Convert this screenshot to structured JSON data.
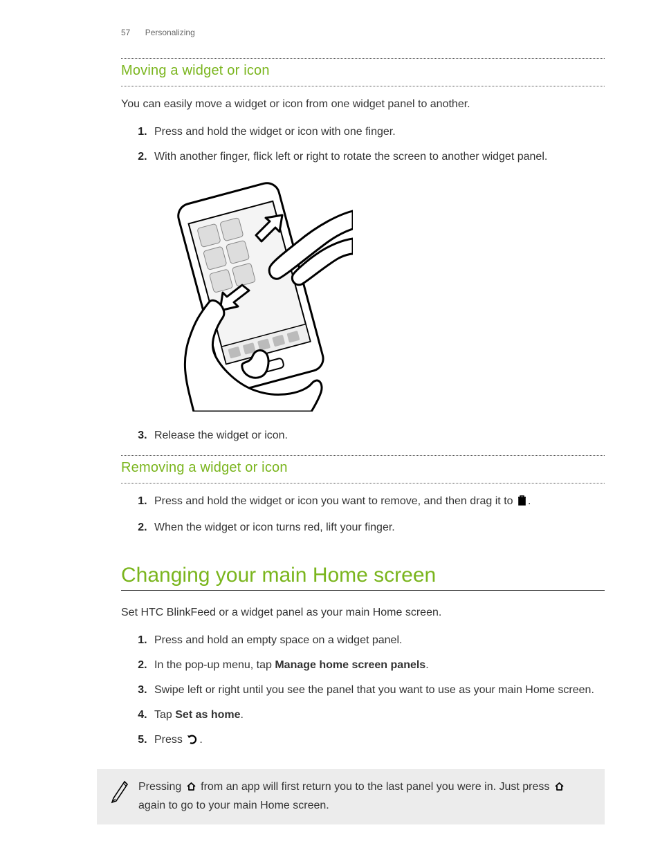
{
  "header": {
    "page_number": "57",
    "section": "Personalizing"
  },
  "section1": {
    "title": "Moving a widget or icon",
    "intro": "You can easily move a widget or icon from one widget panel to another.",
    "steps": [
      "Press and hold the widget or icon with one finger.",
      "With another finger, flick left or right to rotate the screen to another widget panel.",
      "Release the widget or icon."
    ]
  },
  "section2": {
    "title": "Removing a widget or icon",
    "step1_pre": "Press and hold the widget or icon you want to remove, and then drag it to ",
    "step1_post": ".",
    "step2": "When the widget or icon turns red, lift your finger."
  },
  "section3": {
    "title": "Changing your main Home screen",
    "intro": "Set HTC BlinkFeed or a widget panel as your main Home screen.",
    "step1": "Press and hold an empty space on a widget panel.",
    "step2_pre": "In the pop-up menu, tap ",
    "step2_bold": "Manage home screen panels",
    "step2_post": ".",
    "step3": "Swipe left or right until you see the panel that you want to use as your main Home screen.",
    "step4_pre": "Tap ",
    "step4_bold": "Set as home",
    "step4_post": ".",
    "step5_pre": "Press ",
    "step5_post": "."
  },
  "note": {
    "part1": "Pressing ",
    "part2": " from an app will first return you to the last panel you were in. Just press ",
    "part3": " again to go to your main Home screen."
  },
  "icons": {
    "trash": "trash-icon",
    "back": "back-icon",
    "home": "home-icon",
    "pen": "pen-icon"
  }
}
